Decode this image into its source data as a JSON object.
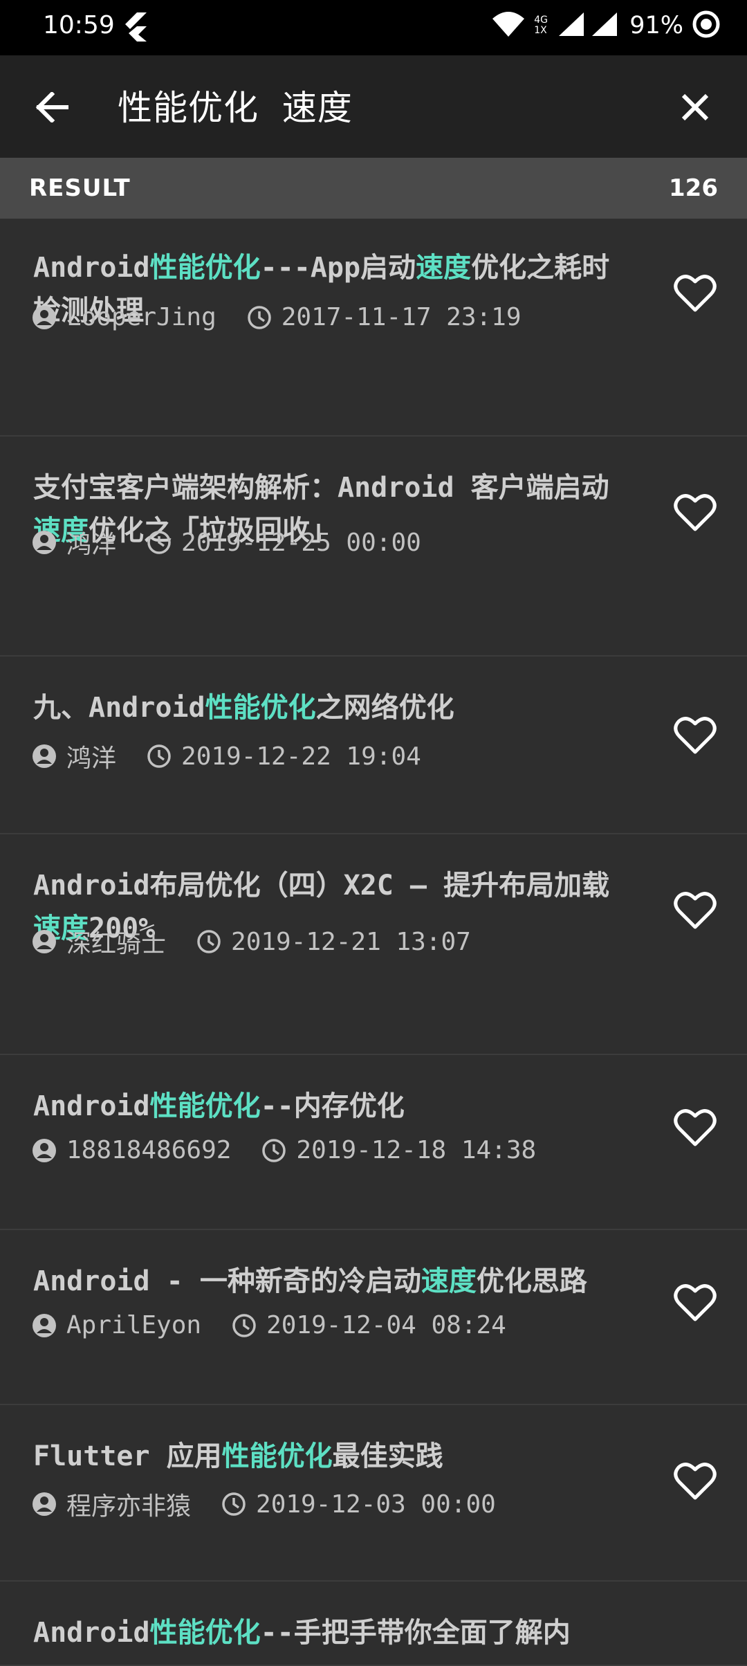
{
  "status_bar": {
    "time": "10:59",
    "network": "4G 1X",
    "battery": "91%"
  },
  "app_bar": {
    "query": "性能优化  速度"
  },
  "results": {
    "label": "RESULT",
    "count": "126"
  },
  "highlight_color": "#5de0c4",
  "articles": [
    {
      "title": [
        {
          "t": "Android"
        },
        {
          "t": "性能优化",
          "h": true
        },
        {
          "t": "---App启动"
        },
        {
          "t": "速度",
          "h": true
        },
        {
          "t": "优化之耗时检测处理"
        }
      ],
      "author": "LooperJing",
      "date": "2017-11-17 23:19"
    },
    {
      "title": [
        {
          "t": "支付宝客户端架构解析：Android 客户端启动"
        },
        {
          "t": "速度",
          "h": true
        },
        {
          "t": "优化之「垃圾回收」"
        }
      ],
      "author": "鸿洋",
      "date": "2019-12-25 00:00"
    },
    {
      "title": [
        {
          "t": "九、Android"
        },
        {
          "t": "性能优化",
          "h": true
        },
        {
          "t": "之网络优化"
        }
      ],
      "author": "鸿洋",
      "date": "2019-12-22 19:04"
    },
    {
      "title": [
        {
          "t": "Android布局优化（四）X2C — 提升布局加载"
        },
        {
          "t": "速度",
          "h": true
        },
        {
          "t": "200%"
        }
      ],
      "author": "深红骑士",
      "date": "2019-12-21 13:07"
    },
    {
      "title": [
        {
          "t": "Android"
        },
        {
          "t": "性能优化",
          "h": true
        },
        {
          "t": "--内存优化"
        }
      ],
      "author": "18818486692",
      "date": "2019-12-18 14:38"
    },
    {
      "title": [
        {
          "t": "Android - 一种新奇的冷启动"
        },
        {
          "t": "速度",
          "h": true
        },
        {
          "t": "优化思路"
        }
      ],
      "author": "AprilEyon",
      "date": "2019-12-04 08:24"
    },
    {
      "title": [
        {
          "t": "Flutter 应用"
        },
        {
          "t": "性能优化",
          "h": true
        },
        {
          "t": "最佳实践"
        }
      ],
      "author": "程序亦非猿",
      "date": "2019-12-03 00:00"
    },
    {
      "title": [
        {
          "t": "Android"
        },
        {
          "t": "性能优化",
          "h": true
        },
        {
          "t": "--手把手带你全面了解内"
        }
      ],
      "author": "",
      "date": ""
    }
  ]
}
